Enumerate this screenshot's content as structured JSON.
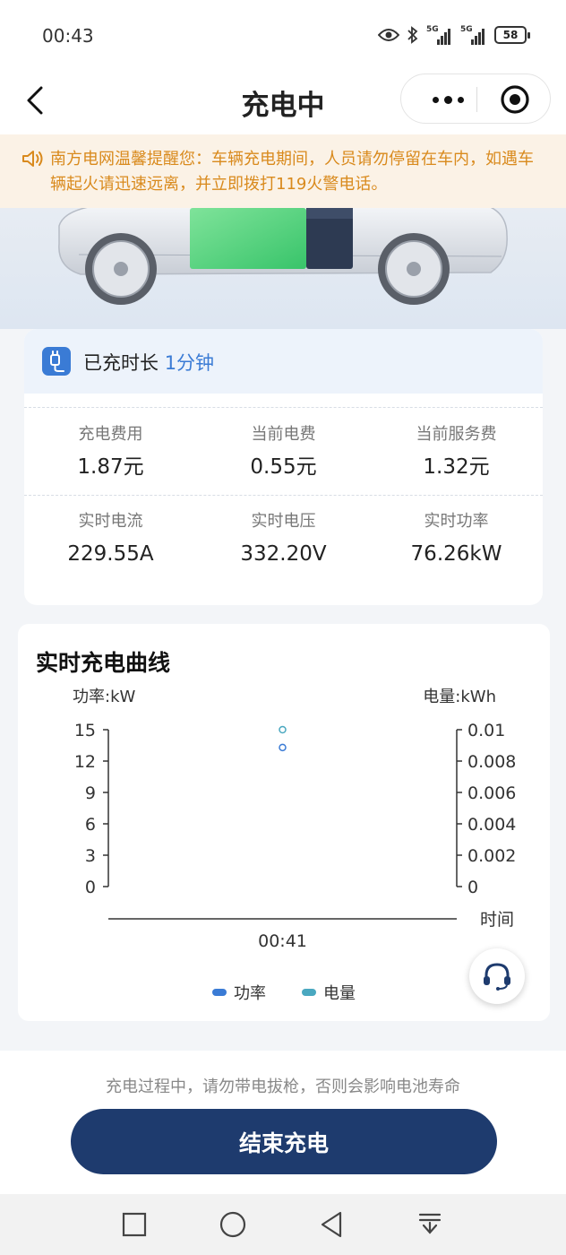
{
  "status_bar": {
    "time": "00:43",
    "battery": "58",
    "net1": "5G",
    "net2": "5G"
  },
  "nav": {
    "title": "充电中"
  },
  "notice": {
    "text": "南方电网温馨提醒您：车辆充电期间，人员请勿停留在车内，如遇车辆起火请迅速远离，并立即拨打119火警电话。"
  },
  "duration": {
    "label": "已充时长",
    "value": "1分钟"
  },
  "stats": [
    {
      "label": "充电费用",
      "value": "1.87元"
    },
    {
      "label": "当前电费",
      "value": "0.55元"
    },
    {
      "label": "当前服务费",
      "value": "1.32元"
    },
    {
      "label": "实时电流",
      "value": "229.55A"
    },
    {
      "label": "实时电压",
      "value": "332.20V"
    },
    {
      "label": "实时功率",
      "value": "76.26kW"
    }
  ],
  "colors": {
    "accent": "#3a7bd5",
    "primary_button": "#1e3b6e",
    "notice_text": "#d98a1d",
    "power": "#3a7bd5",
    "energy": "#4aa8c0"
  },
  "chart_data": {
    "type": "scatter",
    "title": "实时充电曲线",
    "left_axis_label": "功率:kW",
    "right_axis_label": "电量:kWh",
    "x_axis_label": "时间",
    "x_categories": [
      "00:41"
    ],
    "y_left_ticks": [
      "15",
      "12",
      "9",
      "6",
      "3",
      "0"
    ],
    "y_right_ticks": [
      "0.01",
      "0.008",
      "0.006",
      "0.004",
      "0.002",
      "0"
    ],
    "y_left_range": [
      0,
      15
    ],
    "y_right_range": [
      0,
      0.01
    ],
    "series": [
      {
        "name": "功率",
        "axis": "left",
        "color": "#3a7bd5",
        "points": [
          {
            "x": "00:41",
            "y": 13.3
          }
        ]
      },
      {
        "name": "电量",
        "axis": "left",
        "color": "#4aa8c0",
        "points": [
          {
            "x": "00:41",
            "y": 15.0
          }
        ]
      }
    ],
    "legend_position": "bottom-center"
  },
  "support": {
    "icon": "headset-icon"
  },
  "bottom": {
    "warning": "充电过程中，请勿带电拔枪，否则会影响电池寿命",
    "end_button": "结束充电"
  }
}
